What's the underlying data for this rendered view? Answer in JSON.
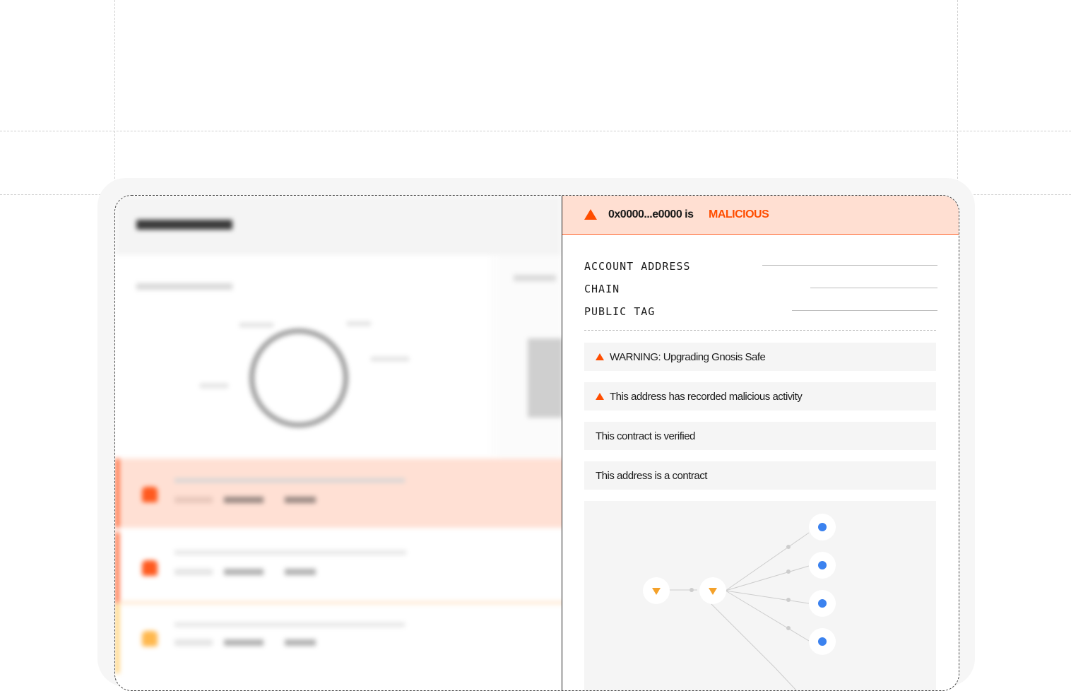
{
  "background_app": {
    "risk_colors": [
      "#ff5a1f",
      "#ff5a1f",
      "#ffb84d"
    ]
  },
  "panel": {
    "header": {
      "title": "0x0000...e0000 is",
      "status": "MALICIOUS",
      "status_color": "#ff4d00",
      "icon": "warning-triangle-icon"
    },
    "fields": [
      {
        "label": "ACCOUNT ADDRESS"
      },
      {
        "label": "CHAIN"
      },
      {
        "label": "PUBLIC TAG"
      }
    ],
    "checks": [
      {
        "text": "WARNING: Upgrading Gnosis Safe",
        "icon": "warning-triangle-icon"
      },
      {
        "text": "This address has recorded malicious activity",
        "icon": "warning-triangle-icon"
      },
      {
        "text": "This contract is verified",
        "icon": ""
      },
      {
        "text": "This address is a contract",
        "icon": ""
      }
    ],
    "graph": {
      "source_nodes": [
        "warning-node-icon",
        "warning-node-icon"
      ],
      "target_nodes": [
        "address-node-icon",
        "address-node-icon",
        "address-node-icon",
        "address-node-icon"
      ]
    }
  }
}
